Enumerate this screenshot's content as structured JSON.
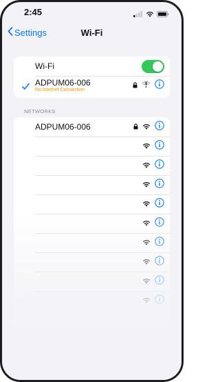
{
  "status_bar": {
    "time": "2:45",
    "icons": [
      "signal-icon",
      "wifi-icon",
      "battery-icon"
    ]
  },
  "nav": {
    "back_label": "Settings",
    "title": "Wi-Fi"
  },
  "wifi_card": {
    "toggle_label": "Wi-Fi",
    "toggle_on": true,
    "connected_network": {
      "name": "ADPUM06-006",
      "status": "No Internet Connection",
      "status_color": "#ff9500",
      "icons": [
        "lock-icon",
        "wifi-warning-icon",
        "info-icon"
      ]
    }
  },
  "networks_section": {
    "header": "NETWORKS",
    "items": [
      {
        "name": "ADPUM06-006",
        "secured": true
      },
      {
        "name": "",
        "secured": false
      },
      {
        "name": "",
        "secured": false
      },
      {
        "name": "",
        "secured": false
      },
      {
        "name": "",
        "secured": false
      },
      {
        "name": "",
        "secured": false
      },
      {
        "name": "",
        "secured": false
      },
      {
        "name": "",
        "secured": false
      },
      {
        "name": "",
        "secured": false
      },
      {
        "name": "",
        "secured": false
      }
    ]
  },
  "colors": {
    "accent": "#0a7aff",
    "toggle_on": "#34c759",
    "background": "#f2f2f7",
    "warning": "#ff9500"
  }
}
